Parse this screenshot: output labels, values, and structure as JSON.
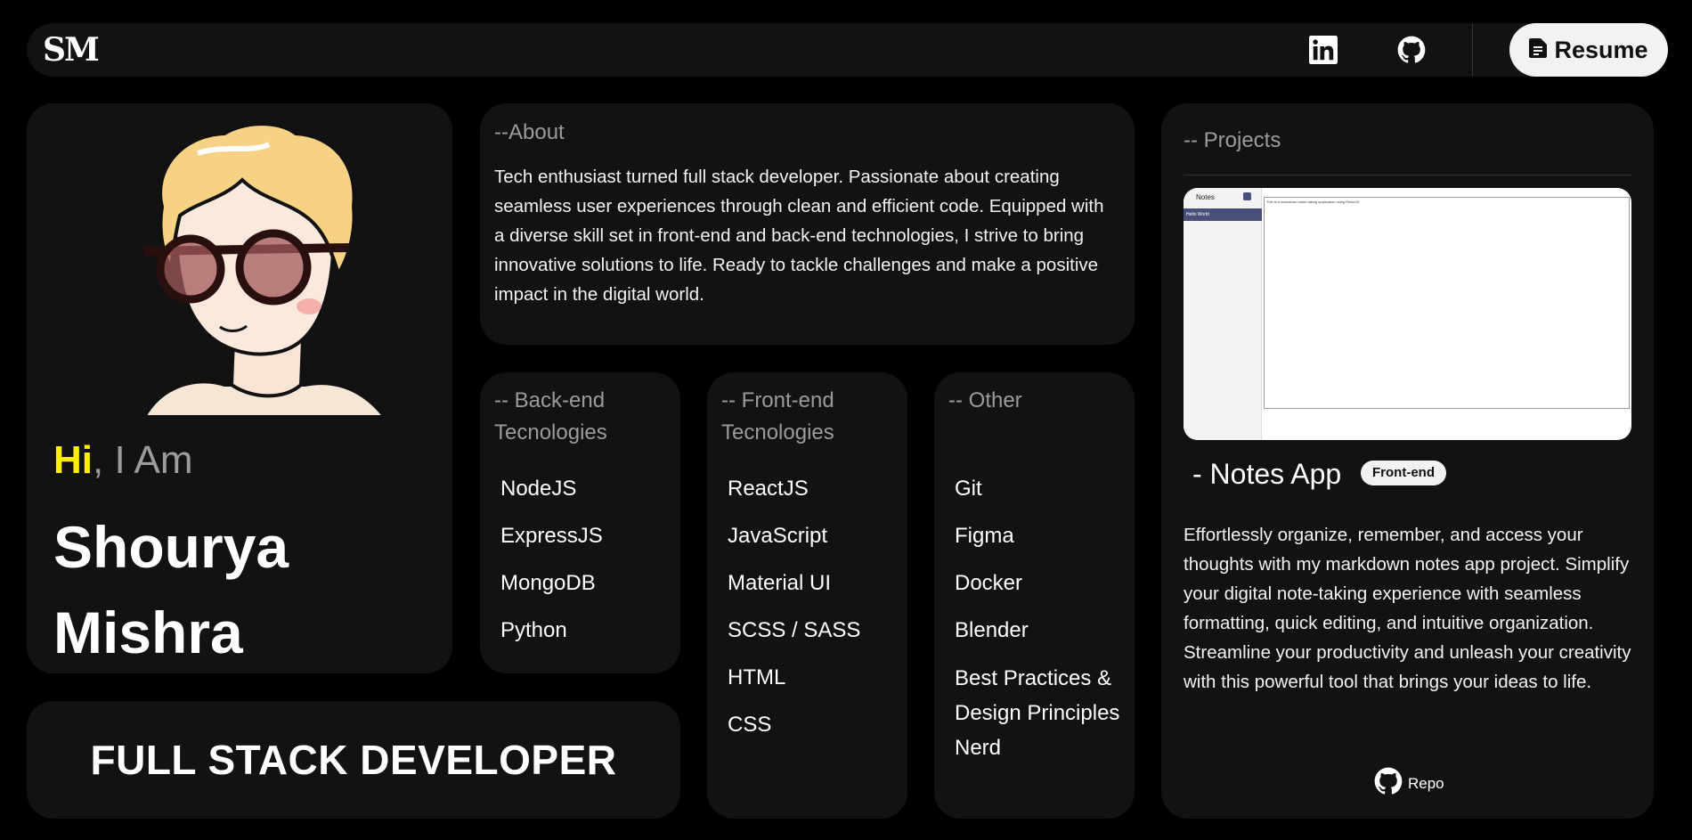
{
  "nav": {
    "logo": "SM",
    "icons": [
      "linkedin-icon",
      "github-icon"
    ],
    "resume_label": "Resume"
  },
  "profile": {
    "greeting_hi": "Hi",
    "greeting_rest": ", I Am",
    "first_name": "Shourya",
    "last_name": "Mishra",
    "accent_color": "#ffee00"
  },
  "about": {
    "title": "--About",
    "text": "Tech enthusiast turned full stack developer. Passionate about creating seamless user experiences through clean and efficient code. Equipped with a diverse skill set in front-end and back-end technologies, I strive to bring innovative solutions to life. Ready to tackle challenges and make a positive impact in the digital world."
  },
  "backend": {
    "title": "-- Back-end Tecnologies",
    "items": [
      "NodeJS",
      "ExpressJS",
      "MongoDB",
      "Python"
    ]
  },
  "frontend": {
    "title": "-- Front-end Tecnologies",
    "items": [
      "ReactJS",
      "JavaScript",
      "Material UI",
      "SCSS / SASS",
      "HTML",
      "CSS"
    ]
  },
  "other": {
    "title": "-- Other",
    "items": [
      "Git",
      "Figma",
      "Docker",
      "Blender",
      "Best Practices & Design Principles Nerd"
    ]
  },
  "role": {
    "text": "FULL STACK DEVELOPER"
  },
  "projects": {
    "title": "-- Projects",
    "screenshot": {
      "sidebar_title": "Notes",
      "sidebar_item": "Hello World",
      "editor_text": "This is a markdown notes taking application using ReactJS"
    },
    "name": "- Notes App",
    "badge": "Front-end",
    "description": "Effortlessly organize, remember, and access your thoughts with my markdown notes app project. Simplify your digital note-taking experience with seamless formatting, quick editing, and intuitive organization. Streamline your productivity and unleash your creativity with this powerful tool that brings your ideas to life.",
    "repo_label": "Repo"
  }
}
